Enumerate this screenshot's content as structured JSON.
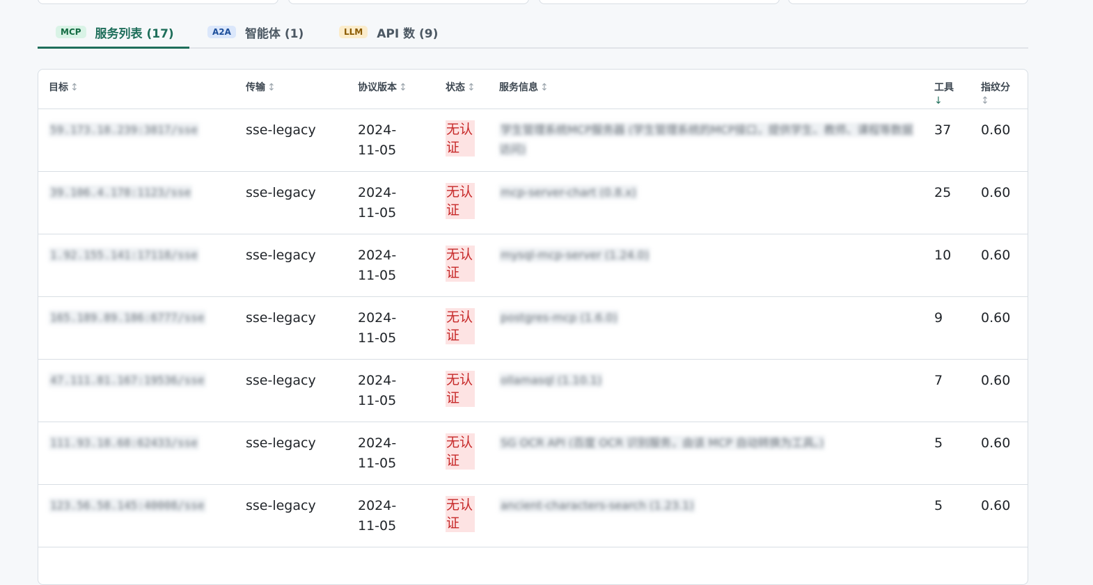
{
  "tabs": [
    {
      "badge": "MCP",
      "label": "服务列表 (17)",
      "active": true
    },
    {
      "badge": "A2A",
      "label": "智能体 (1)",
      "active": false
    },
    {
      "badge": "LLM",
      "label": "API 数 (9)",
      "active": false
    }
  ],
  "table": {
    "headers": {
      "target": "目标",
      "transport": "传输",
      "protocol": "协议版本",
      "status": "状态",
      "info": "服务信息",
      "tools": "工具",
      "fingerprint": "指纹分"
    },
    "sort_icons": {
      "neutral": "↕",
      "desc": "↓"
    },
    "rows": [
      {
        "target": "59.173.18.239:3817/sse",
        "transport": "sse-legacy",
        "protocol": "2024-11-05",
        "status": "无认证",
        "info": "学生管理系统MCP服务器 (学生管理系统的MCP接口，提供学生、教师、课程等数据访问)",
        "tools": "37",
        "fingerprint": "0.60"
      },
      {
        "target": "39.106.4.178:1123/sse",
        "transport": "sse-legacy",
        "protocol": "2024-11-05",
        "status": "无认证",
        "info": "mcp-server-chart (0.8.x)",
        "tools": "25",
        "fingerprint": "0.60"
      },
      {
        "target": "1.92.155.141:17118/sse",
        "transport": "sse-legacy",
        "protocol": "2024-11-05",
        "status": "无认证",
        "info": "mysql-mcp-server (1.24.0)",
        "tools": "10",
        "fingerprint": "0.60"
      },
      {
        "target": "165.189.89.186:6777/sse",
        "transport": "sse-legacy",
        "protocol": "2024-11-05",
        "status": "无认证",
        "info": "postgres-mcp (1.6.0)",
        "tools": "9",
        "fingerprint": "0.60"
      },
      {
        "target": "47.111.81.167:19536/sse",
        "transport": "sse-legacy",
        "protocol": "2024-11-05",
        "status": "无认证",
        "info": "ollamasql (1.10.1)",
        "tools": "7",
        "fingerprint": "0.60"
      },
      {
        "target": "111.93.18.68:62433/sse",
        "transport": "sse-legacy",
        "protocol": "2024-11-05",
        "status": "无认证",
        "info": "SG OCR API (百度 OCR 识别服务，由该 MCP 自动转换为工具。)",
        "tools": "5",
        "fingerprint": "0.60"
      },
      {
        "target": "123.56.58.145:40008/sse",
        "transport": "sse-legacy",
        "protocol": "2024-11-05",
        "status": "无认证",
        "info": "ancient-characters-search (1.23.1)",
        "tools": "5",
        "fingerprint": "0.60"
      }
    ]
  }
}
